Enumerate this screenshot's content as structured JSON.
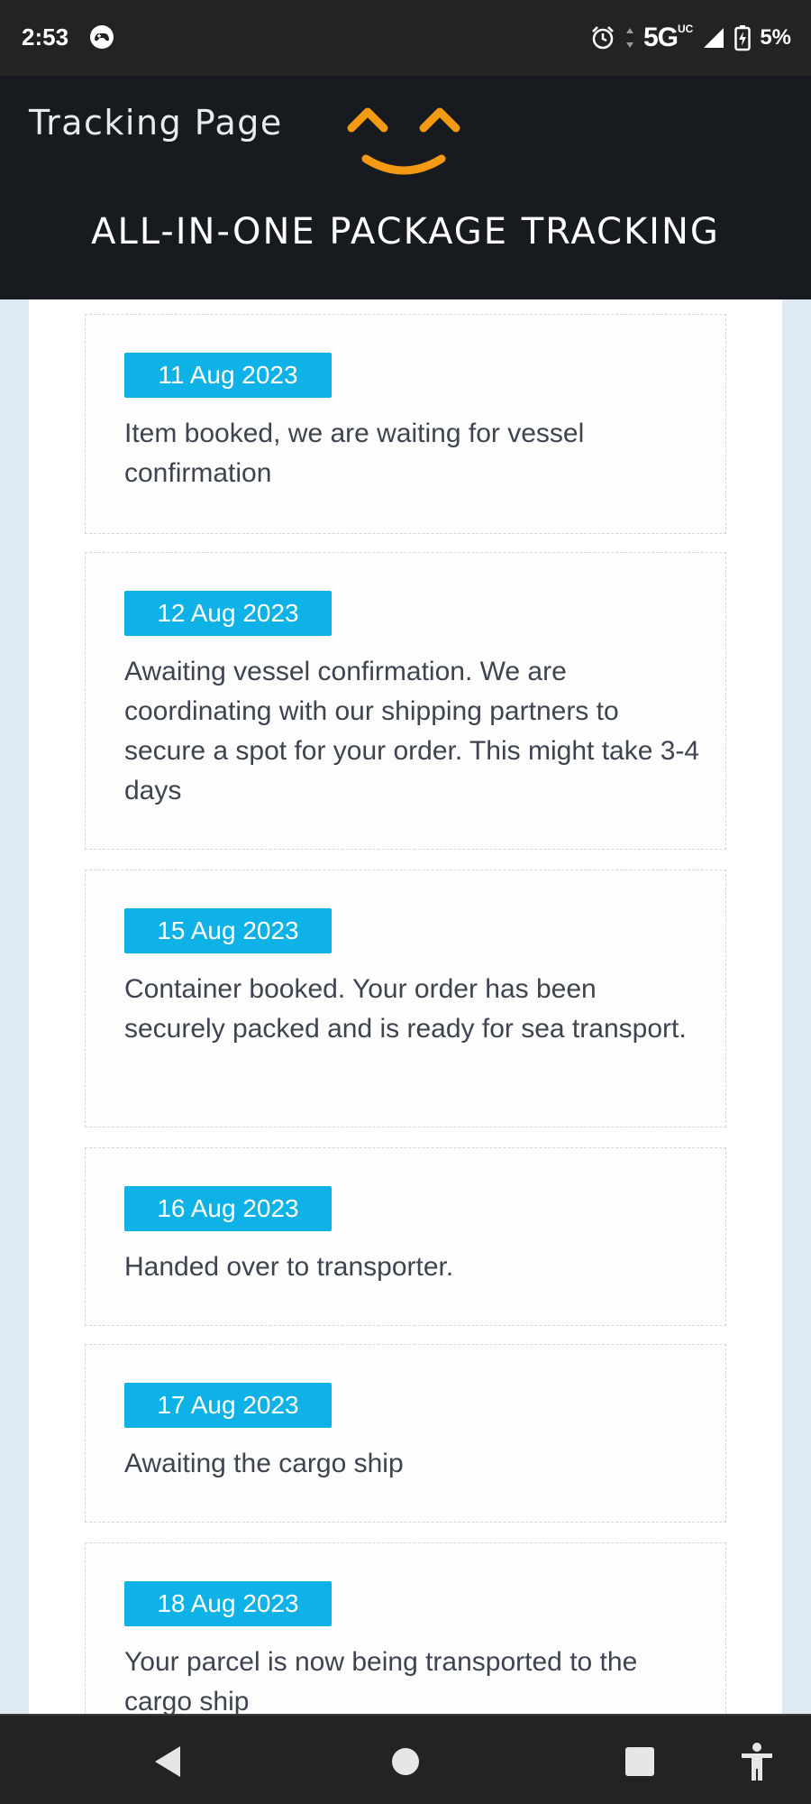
{
  "status_bar": {
    "time": "2:53",
    "network": "5G",
    "network_sup": "UC",
    "battery": "5%",
    "icons": [
      "game-controller-icon",
      "alarm-icon",
      "signal-icon",
      "battery-charging-icon"
    ]
  },
  "header": {
    "title": "Tracking Page",
    "subtitle": "ALL-IN-ONE PACKAGE TRACKING",
    "logo_color": "#f39a12"
  },
  "timeline": [
    {
      "date": "11 Aug 2023",
      "text": "Item booked, we are waiting for vessel confirmation"
    },
    {
      "date": "12 Aug 2023",
      "text": "Awaiting vessel confirmation. We are coordinating with our shipping partners to secure a spot for your order. This might take 3-4 days"
    },
    {
      "date": "15 Aug 2023",
      "text": "Container booked. Your order has been securely packed and is ready for sea transport."
    },
    {
      "date": "16 Aug 2023",
      "text": "Handed over to transporter."
    },
    {
      "date": "17 Aug 2023",
      "text": "Awaiting the cargo ship"
    },
    {
      "date": "18 Aug 2023",
      "text": "Your parcel is now being transported to the cargo ship"
    }
  ],
  "nav_bar": {
    "icons": [
      "back-icon",
      "home-icon",
      "recents-icon",
      "accessibility-icon"
    ]
  },
  "colors": {
    "badge": "#0fb2e6",
    "header_bg": "#171a1f",
    "page_bg": "#dfeaf3"
  }
}
